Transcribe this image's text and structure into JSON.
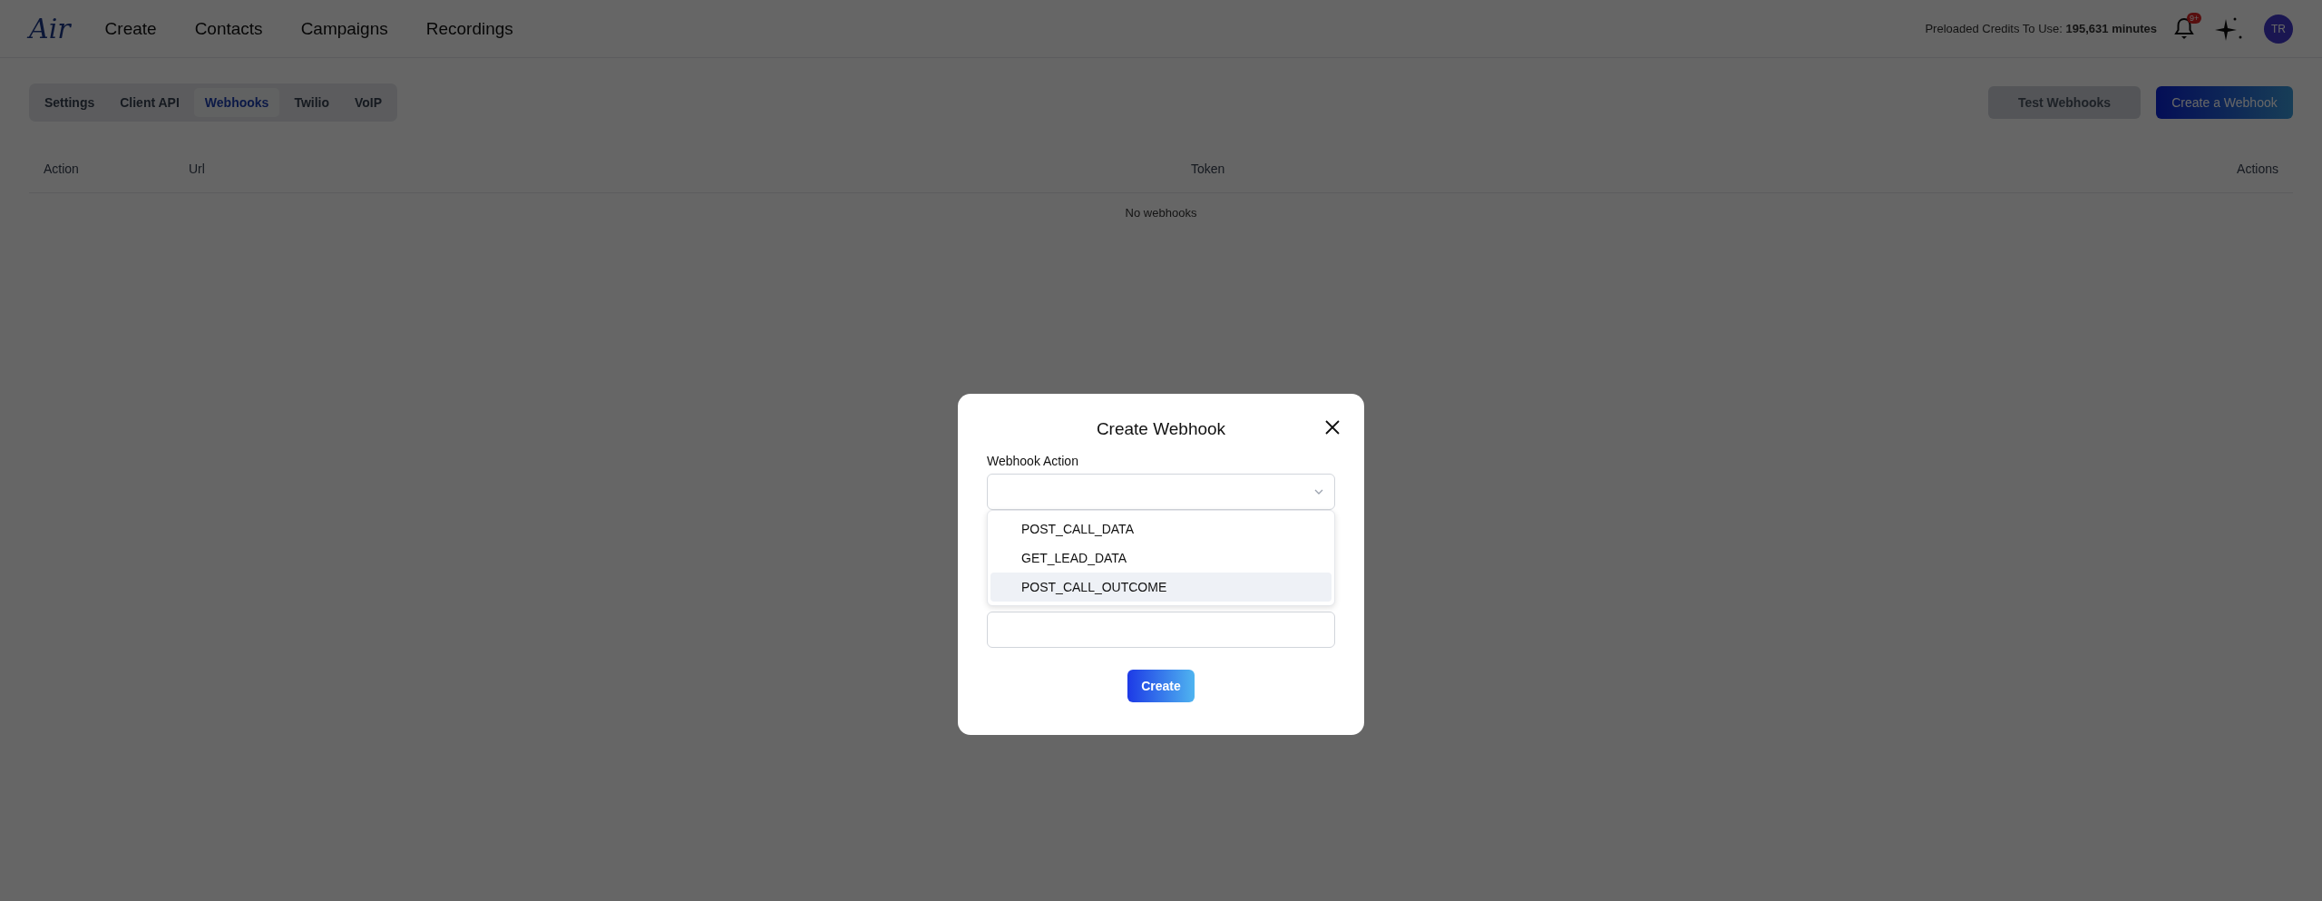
{
  "nav": {
    "logo": "Air",
    "items": [
      "Create",
      "Contacts",
      "Campaigns",
      "Recordings"
    ]
  },
  "header": {
    "credits": "Preloaded Credits To Use: **195,631 minutes**",
    "notification_badge": "9+",
    "avatar": "TR"
  },
  "tabs": [
    {
      "label": "Settings",
      "selected": false
    },
    {
      "label": "Client API",
      "selected": false
    },
    {
      "label": "Webhooks",
      "selected": true
    },
    {
      "label": "Twilio",
      "selected": false
    },
    {
      "label": "VoIP",
      "selected": false
    }
  ],
  "actions": [
    {
      "label": "Test Webhooks",
      "disabled": true,
      "kind": "secondary"
    },
    {
      "label": "Create a Webhook",
      "disabled": false,
      "kind": "primary"
    }
  ],
  "table": {
    "columns": [
      "Action",
      "Url",
      "Token",
      "Actions"
    ],
    "empty_message": "No webhooks"
  },
  "modal": {
    "title": "Create Webhook",
    "action_label": "Webhook Action",
    "dropdown_expanded": true,
    "options": [
      {
        "label": "POST_CALL_DATA",
        "selected": false
      },
      {
        "label": "GET_LEAD_DATA",
        "selected": false
      },
      {
        "label": "POST_CALL_OUTCOME",
        "selected": true
      }
    ],
    "submit": "Create"
  }
}
